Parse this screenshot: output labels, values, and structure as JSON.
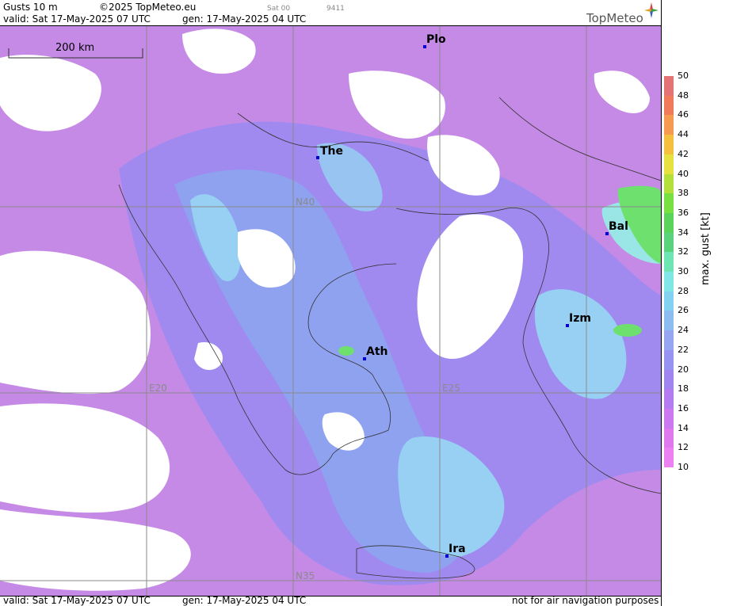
{
  "header": {
    "product": "Gusts 10 m",
    "copyright": "©2025 TopMeteo.eu",
    "run": "Sat 00",
    "code": "9411",
    "valid": "valid:  Sat  17-May-2025  07 UTC",
    "generated": "gen: 17-May-2025 04 UTC",
    "brand": "TopMeteo"
  },
  "scale_bar": {
    "label": "200 km"
  },
  "grid_labels": {
    "n40": "N40",
    "n35": "N35",
    "e20": "E20",
    "e25": "E25"
  },
  "cities": [
    {
      "name": "Plo"
    },
    {
      "name": "The"
    },
    {
      "name": "Bal"
    },
    {
      "name": "Izm"
    },
    {
      "name": "Ath"
    },
    {
      "name": "Ira"
    }
  ],
  "footer": {
    "valid": "valid:  Sat  17-May-2025  07 UTC",
    "generated": "gen: 17-May-2025 04 UTC",
    "disclaimer": "not for air navigation purposes"
  },
  "legend": {
    "unit_label": "max. gust  [kt]",
    "values": [
      50,
      48,
      46,
      44,
      42,
      40,
      38,
      36,
      34,
      32,
      30,
      28,
      26,
      24,
      22,
      20,
      18,
      16,
      14,
      12,
      10
    ],
    "colors": [
      "#e47474",
      "#f07a5a",
      "#f59a50",
      "#f5c040",
      "#e6e040",
      "#b4e03c",
      "#78e040",
      "#5ad45a",
      "#5ad47c",
      "#6ee6b4",
      "#82e6e6",
      "#82d2f0",
      "#8cbcf0",
      "#96a6f0",
      "#9694f0",
      "#a084f0",
      "#b47cf0",
      "#cc78ee",
      "#e078ee",
      "#ec82f2"
    ]
  }
}
